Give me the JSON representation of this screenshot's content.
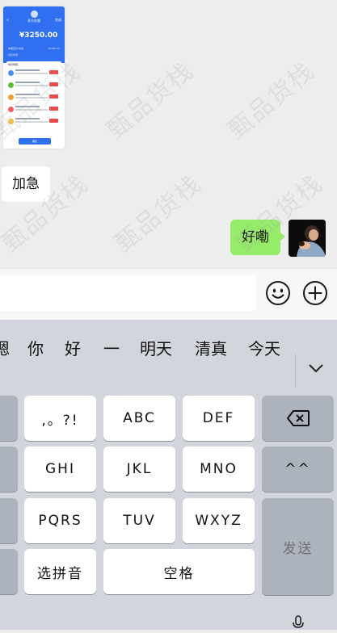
{
  "chat": {
    "thumbnail": {
      "header_title": "多方存管",
      "back": "<",
      "done": "完成",
      "amount": "¥3250.00",
      "label_left": "本期应还/本金",
      "label_right": "¥1060.00",
      "label_left2": "待还款项",
      "card_title": "借款明细",
      "confirm": "确定"
    },
    "messages": [
      {
        "side": "left",
        "text": "加急"
      },
      {
        "side": "right",
        "text": "好嘞"
      }
    ],
    "watermark": "甄品货栈"
  },
  "input": {
    "emoji_icon": "smile-icon",
    "plus_icon": "plus-circle-icon"
  },
  "keyboard": {
    "candidates": [
      "嗯",
      "你",
      "好",
      "一",
      "明天",
      "清真",
      "今天"
    ],
    "collapse_icon": "chevron-down-icon",
    "keys": {
      "punct": ",。?!",
      "abc": "ABC",
      "def": "DEF",
      "ghi": "GHI",
      "jkl": "JKL",
      "mno": "MNO",
      "pqrs": "PQRS",
      "tuv": "TUV",
      "wxyz": "WXYZ",
      "face": "^^",
      "send": "发送",
      "pinyin": "选拼音",
      "space": "空格"
    },
    "backspace_icon": "backspace-icon",
    "mic_icon": "microphone-icon"
  }
}
